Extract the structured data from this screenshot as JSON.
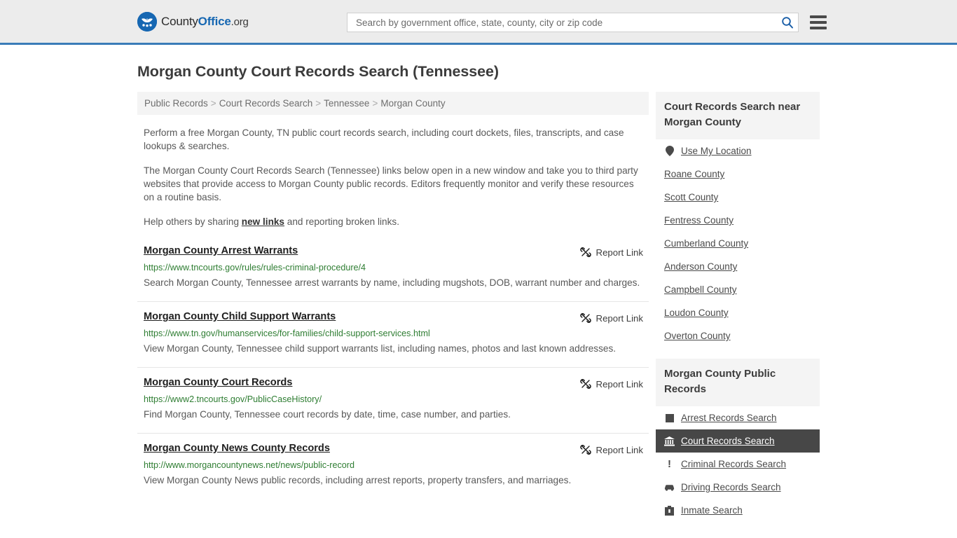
{
  "header": {
    "logo": {
      "text_part1": "County",
      "text_part2": "Office",
      "text_part3": ".org",
      "icon": "eagle-stars-logo"
    },
    "search": {
      "placeholder": "Search by government office, state, county, city or zip code",
      "value": "",
      "icon": "search-icon"
    },
    "menu_icon": "hamburger-menu-icon",
    "accent_color": "#3a7cb8"
  },
  "page": {
    "title": "Morgan County Court Records Search (Tennessee)"
  },
  "breadcrumb": {
    "items": [
      {
        "label": "Public Records"
      },
      {
        "label": "Court Records Search"
      },
      {
        "label": "Tennessee"
      },
      {
        "label": "Morgan County"
      }
    ],
    "separator": ">"
  },
  "intro": {
    "p1": "Perform a free Morgan County, TN public court records search, including court dockets, files, transcripts, and case lookups & searches.",
    "p2": "The Morgan County Court Records Search (Tennessee) links below open in a new window and take you to third party websites that provide access to Morgan County public records. Editors frequently monitor and verify these resources on a routine basis.",
    "p3_before": "Help others by sharing ",
    "p3_link": "new links",
    "p3_after": " and reporting broken links."
  },
  "report_link_label": "Report Link",
  "report_link_icon": "broken-link-icon",
  "results": [
    {
      "title": "Morgan County Arrest Warrants",
      "url": "https://www.tncourts.gov/rules/rules-criminal-procedure/4",
      "description": "Search Morgan County, Tennessee arrest warrants by name, including mugshots, DOB, warrant number and charges."
    },
    {
      "title": "Morgan County Child Support Warrants",
      "url": "https://www.tn.gov/humanservices/for-families/child-support-services.html",
      "description": "View Morgan County, Tennessee child support warrants list, including names, photos and last known addresses."
    },
    {
      "title": "Morgan County Court Records",
      "url": "https://www2.tncourts.gov/PublicCaseHistory/",
      "description": "Find Morgan County, Tennessee court records by date, time, case number, and parties."
    },
    {
      "title": "Morgan County News County Records",
      "url": "http://www.morgancountynews.net/news/public-record",
      "description": "View Morgan County News public records, including arrest reports, property transfers, and marriages."
    }
  ],
  "sidebar": {
    "near_panel": {
      "title": "Court Records Search near Morgan County",
      "items": [
        {
          "label": "Use My Location",
          "icon": "map-pin-icon"
        },
        {
          "label": "Roane County",
          "icon": ""
        },
        {
          "label": "Scott County",
          "icon": ""
        },
        {
          "label": "Fentress County",
          "icon": ""
        },
        {
          "label": "Cumberland County",
          "icon": ""
        },
        {
          "label": "Anderson County",
          "icon": ""
        },
        {
          "label": "Campbell County",
          "icon": ""
        },
        {
          "label": "Loudon County",
          "icon": ""
        },
        {
          "label": "Overton County",
          "icon": ""
        }
      ]
    },
    "records_panel": {
      "title": "Morgan County Public Records",
      "active_index": 1,
      "items": [
        {
          "label": "Arrest Records Search",
          "icon": "fingerprint-square-icon"
        },
        {
          "label": "Court Records Search",
          "icon": "courthouse-icon"
        },
        {
          "label": "Criminal Records Search",
          "icon": "exclamation-icon"
        },
        {
          "label": "Driving Records Search",
          "icon": "car-icon"
        },
        {
          "label": "Inmate Search",
          "icon": "jail-building-icon"
        }
      ]
    }
  }
}
